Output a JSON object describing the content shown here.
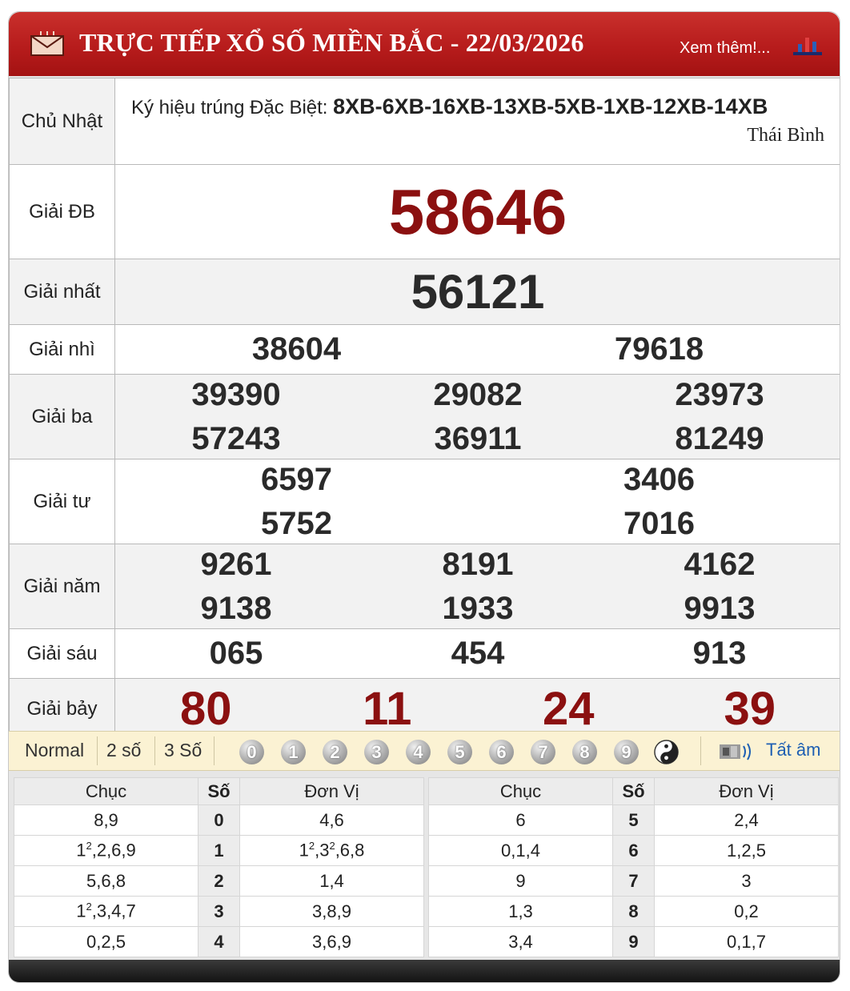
{
  "header": {
    "title": "TRỰC TIẾP XỔ SỐ MIỀN BẮC - 22/03/2026",
    "more_link": "Xem thêm!..."
  },
  "info": {
    "day": "Chủ Nhật",
    "symbol_label": "Ký hiệu trúng Đặc Biệt:",
    "symbol_codes": "8XB-6XB-16XB-13XB-5XB-1XB-12XB-14XB",
    "province": "Thái Bình"
  },
  "prizes": [
    {
      "label": "Giải ĐB",
      "numbers": [
        "58646"
      ]
    },
    {
      "label": "Giải nhất",
      "numbers": [
        "56121"
      ]
    },
    {
      "label": "Giải nhì",
      "numbers": [
        "38604",
        "79618"
      ]
    },
    {
      "label": "Giải ba",
      "numbers": [
        "39390",
        "29082",
        "23973",
        "57243",
        "36911",
        "81249"
      ]
    },
    {
      "label": "Giải tư",
      "numbers": [
        "6597",
        "3406",
        "5752",
        "7016"
      ]
    },
    {
      "label": "Giải năm",
      "numbers": [
        "9261",
        "8191",
        "4162",
        "9138",
        "1933",
        "9913"
      ]
    },
    {
      "label": "Giải sáu",
      "numbers": [
        "065",
        "454",
        "913"
      ]
    },
    {
      "label": "Giải bảy",
      "numbers": [
        "80",
        "11",
        "24",
        "39"
      ]
    }
  ],
  "controls": {
    "modes": [
      "Normal",
      "2 số",
      "3 Số"
    ],
    "balls": [
      "0",
      "1",
      "2",
      "3",
      "4",
      "5",
      "6",
      "7",
      "8",
      "9"
    ],
    "mute_label": "Tất âm"
  },
  "stats": {
    "headers": {
      "tens": "Chục",
      "digit": "Số",
      "units": "Đơn Vị"
    },
    "left": [
      {
        "tens": "8,9",
        "digit": "0",
        "units": "4,6"
      },
      {
        "tens": "1²,2,6,9",
        "digit": "1",
        "units": "1²,3²,6,8"
      },
      {
        "tens": "5,6,8",
        "digit": "2",
        "units": "1,4"
      },
      {
        "tens": "1²,3,4,7",
        "digit": "3",
        "units": "3,8,9"
      },
      {
        "tens": "0,2,5",
        "digit": "4",
        "units": "3,6,9"
      }
    ],
    "right": [
      {
        "tens": "6",
        "digit": "5",
        "units": "2,4"
      },
      {
        "tens": "0,1,4",
        "digit": "6",
        "units": "1,2,5"
      },
      {
        "tens": "9",
        "digit": "7",
        "units": "3"
      },
      {
        "tens": "1,3",
        "digit": "8",
        "units": "0,2"
      },
      {
        "tens": "3,4",
        "digit": "9",
        "units": "0,1,7"
      }
    ]
  },
  "colors": {
    "header_red": "#b71c1c",
    "special_red": "#8b1010",
    "mute_blue": "#1e5fb3",
    "control_bg": "#fbf2d3"
  }
}
